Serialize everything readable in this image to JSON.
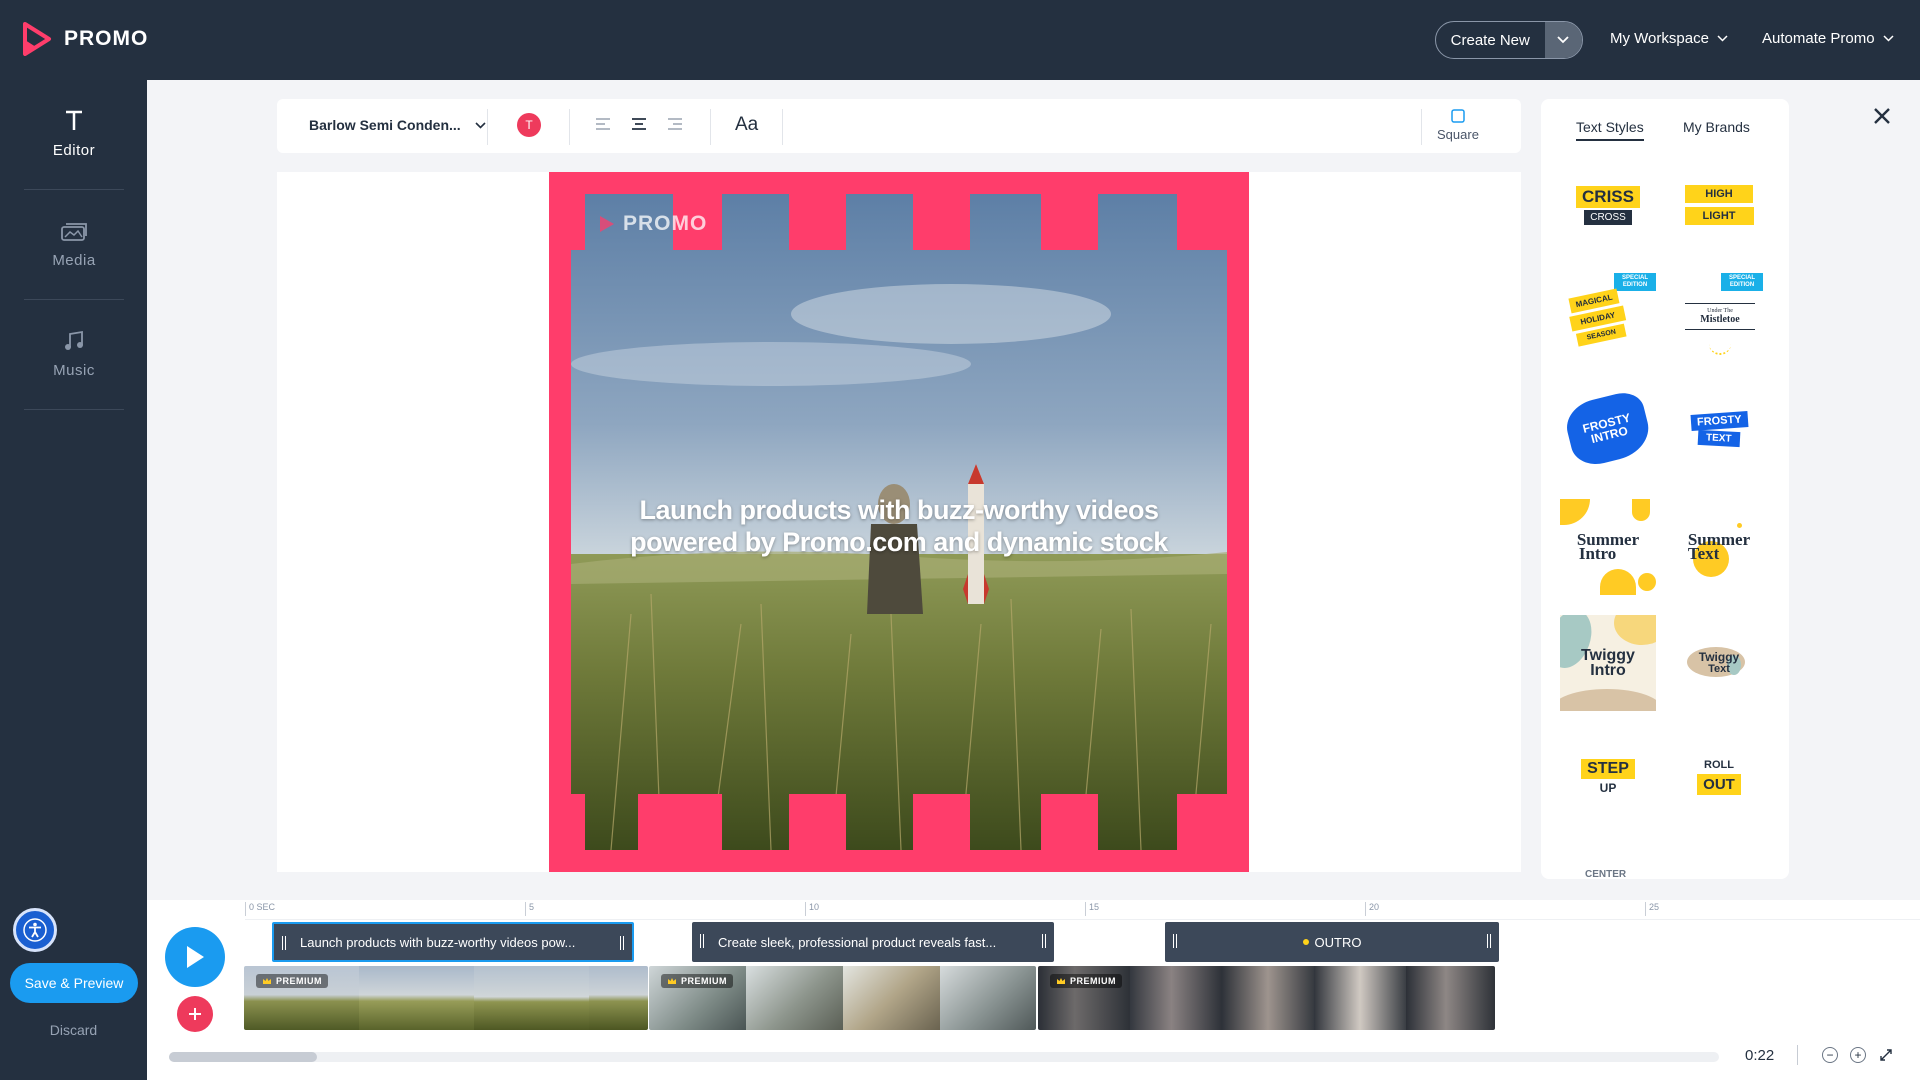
{
  "brand": {
    "name": "PROMO",
    "accent": "#ff3d6b",
    "primary": "#1a9bf0",
    "dark": "#243040"
  },
  "header": {
    "create_new": "Create New",
    "workspace": "My Workspace",
    "automate": "Automate Promo"
  },
  "sidebar": {
    "items": [
      {
        "label": "Editor",
        "icon": "text-icon"
      },
      {
        "label": "Media",
        "icon": "media-icon"
      },
      {
        "label": "Music",
        "icon": "music-icon"
      }
    ],
    "save_preview": "Save & Preview",
    "discard": "Discard"
  },
  "toolbar": {
    "font": "Barlow Semi Conden...",
    "color_letter": "T",
    "case_label": "Aa",
    "format_label": "Square"
  },
  "canvas": {
    "logo": "PROMO",
    "headline_line1": "Launch products with buzz-worthy videos",
    "headline_line2": "powered by Promo.com and dynamic stock"
  },
  "right_panel": {
    "tabs": [
      "Text Styles",
      "My Brands"
    ],
    "active_tab": "Text Styles",
    "styles": [
      {
        "a": "CRISS",
        "b": "CROSS"
      },
      {
        "a": "HIGH",
        "b": "LIGHT"
      },
      {
        "a": "MAGICAL",
        "b": "HOLIDAY",
        "c": "SEASON",
        "badge": "SPECIAL EDITION"
      },
      {
        "a": "Under The",
        "b": "Mistletoe",
        "badge": "SPECIAL EDITION"
      },
      {
        "a": "FROSTY",
        "b": "INTRO"
      },
      {
        "a": "FROSTY",
        "b": "TEXT"
      },
      {
        "a": "Summer",
        "b": "Intro"
      },
      {
        "a": "Summer",
        "b": "Text"
      },
      {
        "a": "Twiggy",
        "b": "Intro"
      },
      {
        "a": "Twiggy",
        "b": "Text"
      },
      {
        "a": "STEP",
        "b": "UP"
      },
      {
        "a": "ROLL",
        "b": "OUT"
      }
    ],
    "partial_label": "CENTER"
  },
  "timeline": {
    "ticks": [
      "0 SEC",
      "5",
      "10",
      "15",
      "20",
      "25"
    ],
    "text_clips": [
      "Launch products with buzz-worthy videos pow...",
      "Create sleek, professional product reveals fast...",
      "OUTRO"
    ],
    "premium_label": "PREMIUM",
    "duration": "0:22"
  }
}
